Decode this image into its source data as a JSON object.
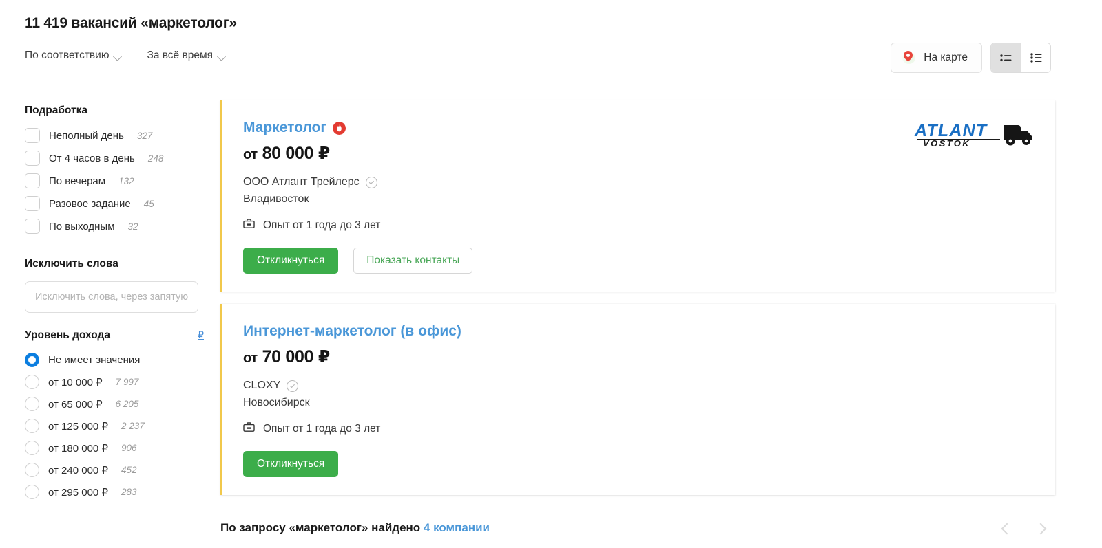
{
  "header": {
    "title": "11 419 вакансий «маркетолог»",
    "sorts": [
      {
        "label": "По соответствию",
        "icon": "chevron-down-icon"
      },
      {
        "label": "За всё время",
        "icon": "chevron-down-icon"
      }
    ],
    "map_button": {
      "label": "На карте",
      "icon": "map-pin-icon"
    },
    "view_toggle": [
      {
        "name": "compact-list-view",
        "active": true
      },
      {
        "name": "detailed-list-view",
        "active": false
      }
    ]
  },
  "sidebar": {
    "part_time": {
      "title": "Подработка",
      "options": [
        {
          "label": "Неполный день",
          "count": "327",
          "checked": false
        },
        {
          "label": "От 4 часов в день",
          "count": "248",
          "checked": false
        },
        {
          "label": "По вечерам",
          "count": "132",
          "checked": false
        },
        {
          "label": "Разовое задание",
          "count": "45",
          "checked": false
        },
        {
          "label": "По выходным",
          "count": "32",
          "checked": false
        }
      ]
    },
    "exclude": {
      "title": "Исключить слова",
      "placeholder": "Исключить слова, через запятую",
      "value": ""
    },
    "income": {
      "title": "Уровень дохода",
      "currency_link": "₽",
      "options": [
        {
          "label": "Не имеет значения",
          "count": "",
          "selected": true
        },
        {
          "label": "от 10 000 ₽",
          "count": "7 997",
          "selected": false
        },
        {
          "label": "от 65 000 ₽",
          "count": "6 205",
          "selected": false
        },
        {
          "label": "от 125 000 ₽",
          "count": "2 237",
          "selected": false
        },
        {
          "label": "от 180 000 ₽",
          "count": "906",
          "selected": false
        },
        {
          "label": "от 240 000 ₽",
          "count": "452",
          "selected": false
        },
        {
          "label": "от 295 000 ₽",
          "count": "283",
          "selected": false
        }
      ]
    }
  },
  "vacancies": [
    {
      "title": "Маркетолог",
      "badge": "hot-fire-icon",
      "salary_prefix": "от",
      "salary": "80 000 ₽",
      "company": "ООО Атлант Трейлерс",
      "verified": true,
      "city": "Владивосток",
      "experience": "Опыт от 1 года до 3 лет",
      "apply_label": "Откликнуться",
      "contacts_label": "Показать контакты",
      "logo": {
        "main": "ATLANT",
        "sub": "VOSTOK",
        "color": "#1a6fc4"
      }
    },
    {
      "title": "Интернет-маркетолог (в офис)",
      "badge": "",
      "salary_prefix": "от",
      "salary": "70 000 ₽",
      "company": "CLOXY",
      "verified": true,
      "city": "Новосибирск",
      "experience": "Опыт от 1 года до 3 лет",
      "apply_label": "Откликнуться",
      "contacts_label": ""
    }
  ],
  "footer": {
    "found_prefix": "По запросу «маркетолог»  найдено ",
    "found_count": "4 компании",
    "pager": {
      "prev": "chevron-left-icon",
      "next": "chevron-right-icon"
    }
  },
  "colors": {
    "accent_blue": "#4a97d8",
    "green": "#3cad4a",
    "card_stripe": "#f1c84b",
    "radio_blue": "#0b7ee0",
    "hot_red": "#e33b31"
  }
}
